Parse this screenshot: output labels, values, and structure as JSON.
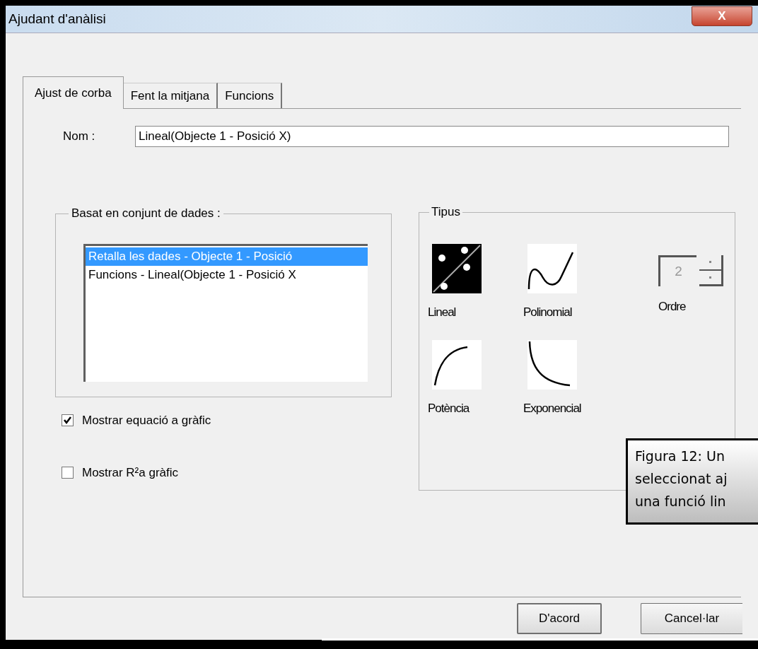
{
  "window": {
    "title": "Ajudant d'anàlisi",
    "close": "X"
  },
  "tabs": [
    {
      "label": "Ajust de corba",
      "selected": true
    },
    {
      "label": "Fent la mitjana",
      "selected": false
    },
    {
      "label": "Funcions",
      "selected": false
    }
  ],
  "name_field": {
    "label": "Nom :",
    "value": "Lineal(Objecte 1 - Posició X)"
  },
  "dataset_group": {
    "title": "Basat en conjunt de dades :",
    "items": [
      {
        "label": "Retalla les dades - Objecte 1 - Posició",
        "selected": true
      },
      {
        "label": "Funcions - Lineal(Objecte 1 - Posició X",
        "selected": false
      }
    ]
  },
  "type_group": {
    "title": "Tipus",
    "options": [
      {
        "kind": "lineal",
        "label": "Lineal",
        "selected": true
      },
      {
        "kind": "polinomial",
        "label": "Polinomial",
        "selected": false
      },
      {
        "kind": "potencia",
        "label": "Potència",
        "selected": false
      },
      {
        "kind": "exponencial",
        "label": "Exponencial",
        "selected": false
      }
    ],
    "order": {
      "label": "Ordre",
      "value": "2",
      "disabled": true
    }
  },
  "checkboxes": [
    {
      "label": "Mostrar equació a gràfic",
      "checked": true
    },
    {
      "label": "Mostrar R²a gràfic",
      "checked": false
    }
  ],
  "buttons": [
    "D'acord",
    "Cancel·lar"
  ],
  "caption": {
    "lines": [
      "Figura 12: Un",
      "seleccionat aj",
      "una funció lin"
    ]
  }
}
